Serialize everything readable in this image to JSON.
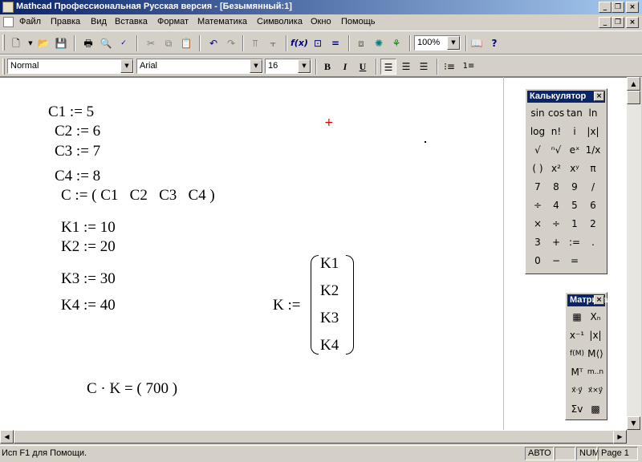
{
  "window": {
    "title": "Mathcad Профессиональная Русская версия - [Безымянный:1]",
    "controls": [
      "_",
      "▫",
      "×"
    ]
  },
  "menu": [
    {
      "label": "Файл"
    },
    {
      "label": "Правка"
    },
    {
      "label": "Вид"
    },
    {
      "label": "Вставка"
    },
    {
      "label": "Формат"
    },
    {
      "label": "Математика"
    },
    {
      "label": "Символика"
    },
    {
      "label": "Окно"
    },
    {
      "label": "Помощь"
    }
  ],
  "toolbar": {
    "zoom": "100%"
  },
  "format_bar": {
    "style": "Normal",
    "font": "Arial",
    "size": "16",
    "bold": "B",
    "italic": "I",
    "underline": "U"
  },
  "worksheet": {
    "c1": "C1 := 5",
    "c2": "C2 := 6",
    "c3": "C3 := 7",
    "c4": "C4 := 8",
    "c_vec": "C := ( C1   C2   C3   C4 )",
    "k1": "K1 := 10",
    "k2": "K2 := 20",
    "k3": "K3 := 30",
    "k4": "K4 := 40",
    "k_def": "K :=",
    "k_matrix": [
      "K1",
      "K2",
      "K3",
      "K4"
    ],
    "result": "C · K = ( 700 )"
  },
  "calculator": {
    "title": "Калькулятор",
    "keys": [
      [
        "sin",
        "cos",
        "tan",
        "ln"
      ],
      [
        "log",
        "n!",
        "i",
        "|x|"
      ],
      [
        "√",
        "ⁿ√",
        "eˣ",
        "1/x"
      ],
      [
        "( )",
        "x²",
        "xʸ",
        "π"
      ],
      [
        "7",
        "8",
        "9",
        "/"
      ],
      [
        "÷",
        "4",
        "5",
        "6"
      ],
      [
        "×",
        "÷",
        "1",
        "2"
      ],
      [
        "3",
        "+",
        ":=",
        "."
      ],
      [
        "0",
        "−",
        "=",
        ""
      ]
    ]
  },
  "matrix_palette": {
    "title": "Матрица",
    "keys": [
      [
        "▦",
        "Xₙ"
      ],
      [
        "x⁻¹",
        "|x|"
      ],
      [
        "f(M)",
        "M⟨⟩"
      ],
      [
        "Mᵀ",
        "m..n"
      ],
      [
        "x⃗·y⃗",
        "x⃗×y⃗"
      ],
      [
        "Σv",
        "▩"
      ]
    ]
  },
  "status": {
    "help": "Исп F1 для Помощи.",
    "mode": "АВТО",
    "num": "NUM",
    "page": "Page 1"
  }
}
